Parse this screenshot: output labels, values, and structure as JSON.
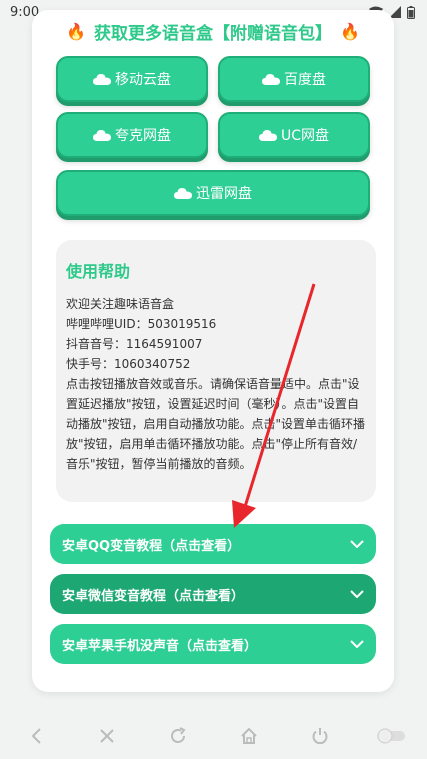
{
  "status": {
    "time": "9:00"
  },
  "title": {
    "text": "获取更多语音盒【附赠语音包】",
    "left_emoji": "🔥",
    "right_emoji": "🔥"
  },
  "disks": [
    {
      "label": "移动云盘"
    },
    {
      "label": "百度盘"
    },
    {
      "label": "夸克网盘"
    },
    {
      "label": "UC网盘"
    },
    {
      "label": "迅雷网盘"
    }
  ],
  "help": {
    "title": "使用帮助",
    "lines": [
      "欢迎关注趣味语音盒",
      "哔哩哔哩UID：503019516",
      "抖音音号：1164591007",
      "快手号：1060340752"
    ],
    "paragraph": "点击按钮播放音效或音乐。请确保语音量适中。点击\"设置延迟播放\"按钮，设置延迟时间（毫秒）。点击\"设置自动播放\"按钮，启用自动播放功能。点击\"设置单击循环播放\"按钮，启用单击循环播放功能。点击\"停止所有音效/音乐\"按钮，暂停当前播放的音频。"
  },
  "accordions": [
    {
      "label": "安卓QQ变音教程（点击查看）"
    },
    {
      "label": "安卓微信变音教程（点击查看）"
    },
    {
      "label": "安卓苹果手机没声音（点击查看）"
    }
  ],
  "colors": {
    "accent": "#2ecf95",
    "accent_dark": "#1da873",
    "title": "#2fc98b",
    "arrow": "#e8262b"
  }
}
